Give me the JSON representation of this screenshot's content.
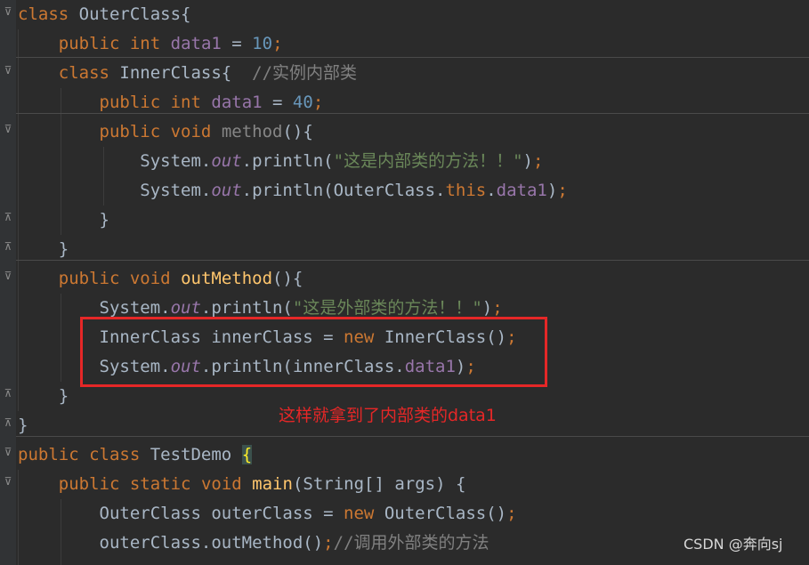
{
  "code": {
    "lines": [
      {
        "tokens": [
          {
            "t": "class",
            "c": "kw"
          },
          {
            "t": " OuterClass{",
            "c": "pl"
          }
        ]
      },
      {
        "tokens": [
          {
            "t": "    "
          },
          {
            "t": "public",
            "c": "kw"
          },
          {
            "t": " "
          },
          {
            "t": "int",
            "c": "kw"
          },
          {
            "t": " "
          },
          {
            "t": "data1",
            "c": "fld"
          },
          {
            "t": " = "
          },
          {
            "t": "10",
            "c": "num"
          },
          {
            "t": ";",
            "c": "kw"
          }
        ]
      },
      {
        "tokens": [
          {
            "t": "    "
          },
          {
            "t": "class",
            "c": "kw"
          },
          {
            "t": " InnerClass{  "
          },
          {
            "t": "//实例内部类",
            "c": "cmt"
          }
        ]
      },
      {
        "tokens": [
          {
            "t": "        "
          },
          {
            "t": "public",
            "c": "kw"
          },
          {
            "t": " "
          },
          {
            "t": "int",
            "c": "kw"
          },
          {
            "t": " "
          },
          {
            "t": "data1",
            "c": "fld"
          },
          {
            "t": " = "
          },
          {
            "t": "40",
            "c": "num"
          },
          {
            "t": ";",
            "c": "kw"
          }
        ]
      },
      {
        "tokens": [
          {
            "t": "        "
          },
          {
            "t": "public",
            "c": "kw"
          },
          {
            "t": " "
          },
          {
            "t": "void",
            "c": "kw"
          },
          {
            "t": " "
          },
          {
            "t": "method",
            "c": "unused"
          },
          {
            "t": "(){"
          }
        ]
      },
      {
        "tokens": [
          {
            "t": "            System."
          },
          {
            "t": "out",
            "c": "fi"
          },
          {
            "t": ".println("
          },
          {
            "t": "\"这是内部类的方法！！\"",
            "c": "str"
          },
          {
            "t": ")"
          },
          {
            "t": ";",
            "c": "kw"
          }
        ]
      },
      {
        "tokens": [
          {
            "t": "            System."
          },
          {
            "t": "out",
            "c": "fi"
          },
          {
            "t": ".println(OuterClass."
          },
          {
            "t": "this",
            "c": "kw"
          },
          {
            "t": "."
          },
          {
            "t": "data1",
            "c": "fld"
          },
          {
            "t": ")"
          },
          {
            "t": ";",
            "c": "kw"
          }
        ]
      },
      {
        "tokens": [
          {
            "t": "        }"
          }
        ]
      },
      {
        "tokens": [
          {
            "t": "    }"
          }
        ]
      },
      {
        "tokens": [
          {
            "t": "    "
          },
          {
            "t": "public",
            "c": "kw"
          },
          {
            "t": " "
          },
          {
            "t": "void",
            "c": "kw"
          },
          {
            "t": " "
          },
          {
            "t": "outMethod",
            "c": "fn"
          },
          {
            "t": "(){"
          }
        ]
      },
      {
        "tokens": [
          {
            "t": "        System."
          },
          {
            "t": "out",
            "c": "fi"
          },
          {
            "t": ".println("
          },
          {
            "t": "\"这是外部类的方法！！\"",
            "c": "str"
          },
          {
            "t": ")"
          },
          {
            "t": ";",
            "c": "kw"
          }
        ]
      },
      {
        "tokens": [
          {
            "t": "        InnerClass innerClass = "
          },
          {
            "t": "new",
            "c": "kw"
          },
          {
            "t": " InnerClass()"
          },
          {
            "t": ";",
            "c": "kw"
          }
        ]
      },
      {
        "tokens": [
          {
            "t": "        System."
          },
          {
            "t": "out",
            "c": "fi"
          },
          {
            "t": ".println(innerClass."
          },
          {
            "t": "data1",
            "c": "fld"
          },
          {
            "t": ")"
          },
          {
            "t": ";",
            "c": "kw"
          }
        ]
      },
      {
        "tokens": [
          {
            "t": "    }"
          }
        ]
      },
      {
        "tokens": [
          {
            "t": "}"
          }
        ]
      },
      {
        "tokens": [
          {
            "t": "public",
            "c": "kw"
          },
          {
            "t": " "
          },
          {
            "t": "class",
            "c": "kw"
          },
          {
            "t": " TestDemo "
          },
          {
            "t": "{",
            "c": "brace-hl"
          }
        ]
      },
      {
        "tokens": [
          {
            "t": "    "
          },
          {
            "t": "public",
            "c": "kw"
          },
          {
            "t": " "
          },
          {
            "t": "static",
            "c": "kw"
          },
          {
            "t": " "
          },
          {
            "t": "void",
            "c": "kw"
          },
          {
            "t": " "
          },
          {
            "t": "main",
            "c": "fn"
          },
          {
            "t": "(String[] args) {"
          }
        ]
      },
      {
        "tokens": [
          {
            "t": "        OuterClass outerClass = "
          },
          {
            "t": "new",
            "c": "kw"
          },
          {
            "t": " OuterClass()"
          },
          {
            "t": ";",
            "c": "kw"
          }
        ]
      },
      {
        "tokens": [
          {
            "t": "        outerClass.outMethod()"
          },
          {
            "t": ";",
            "c": "kw"
          },
          {
            "t": "//调用外部类的方法",
            "c": "cmt"
          }
        ]
      }
    ]
  },
  "annotation": {
    "text": "这样就拿到了内部类的data1",
    "color": "#e52727"
  },
  "watermark": {
    "text": "CSDN @奔向sj"
  },
  "colors": {
    "background": "#2b2b2b",
    "keyword": "#cc7832",
    "number": "#6897bb",
    "field": "#9876aa",
    "string": "#6a8759",
    "comment": "#808080",
    "method_decl": "#ffc66d",
    "plain": "#a9b7c6"
  }
}
